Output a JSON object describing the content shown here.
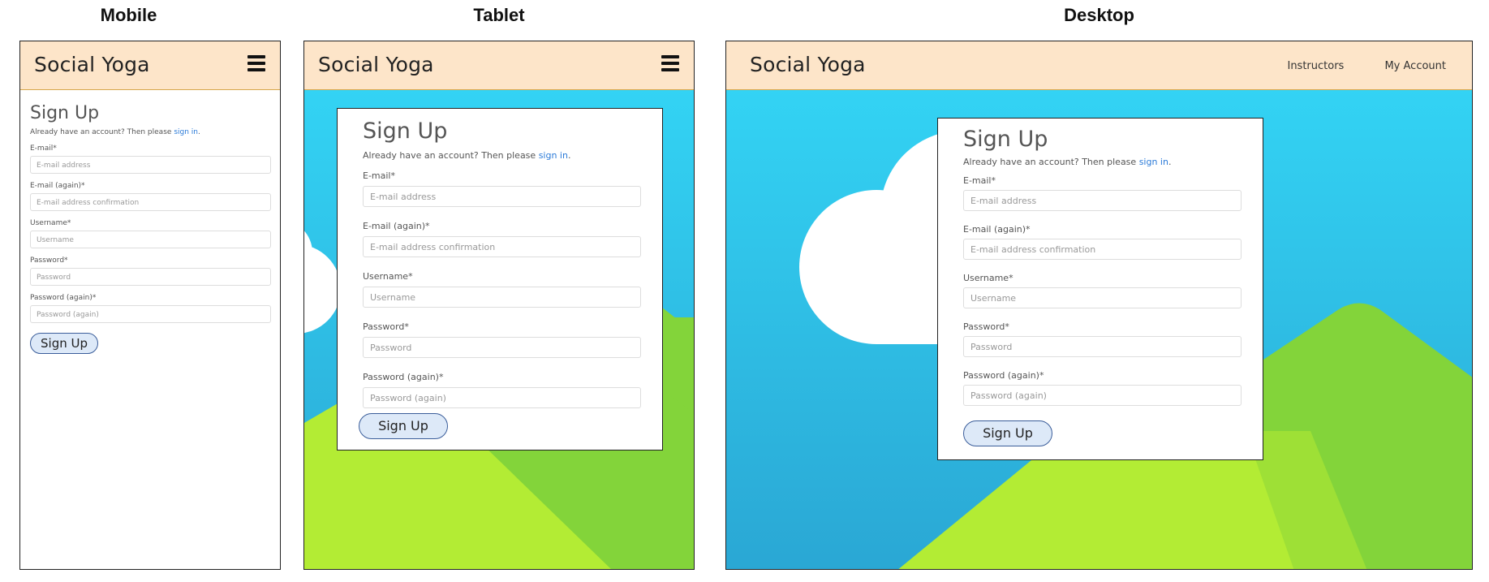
{
  "labels": {
    "mobile": "Mobile",
    "tablet": "Tablet",
    "desktop": "Desktop"
  },
  "app": {
    "brand": "Social Yoga"
  },
  "nav": {
    "instructors": "Instructors",
    "my_account": "My Account"
  },
  "form": {
    "title": "Sign Up",
    "intro": "Already have an account? Then please",
    "signin_link": "sign in",
    "intro_end": ".",
    "fields": {
      "email": {
        "label": "E-mail*",
        "placeholder": "E-mail address"
      },
      "email2": {
        "label": "E-mail (again)*",
        "placeholder": "E-mail address confirmation"
      },
      "username": {
        "label": "Username*",
        "placeholder": "Username"
      },
      "password": {
        "label": "Password*",
        "placeholder": "Password"
      },
      "password2": {
        "label": "Password (again)*",
        "placeholder": "Password (again)"
      }
    },
    "submit": "Sign Up"
  },
  "colors": {
    "nav_bg": "#fde5c9",
    "sky_top": "#33d3f4",
    "sky_bottom": "#2aa7d4",
    "hill_dark": "#83d43a",
    "hill_light": "#b3ec34",
    "link": "#2a7ad8",
    "button_bg": "#dde9f8"
  },
  "icons": {
    "menu": "hamburger-icon",
    "cloud": "cloud-illustration",
    "hills": "hills-illustration"
  }
}
